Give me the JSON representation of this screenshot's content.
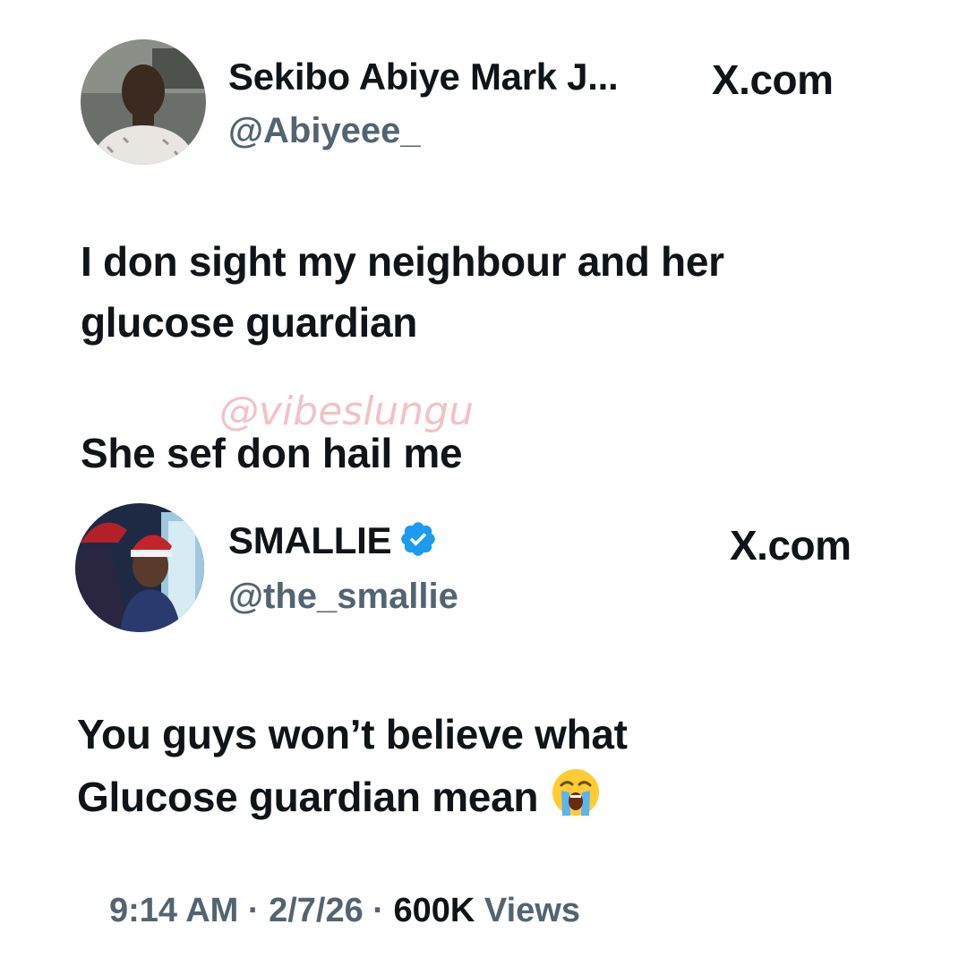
{
  "watermark": "@vibeslungu",
  "tweet1": {
    "display_name": "Sekibo Abiye Mark J...",
    "handle": "@Abiyeee_",
    "source": "X.com",
    "text_line1": "I don sight my neighbour and her",
    "text_line2": "glucose guardian",
    "text_line3": "She sef don hail me"
  },
  "tweet2": {
    "display_name": "SMALLIE",
    "handle": "@the_smallie",
    "source": "X.com",
    "verified": true,
    "text_line1": "You guys won’t believe what",
    "text_line2": "Glucose guardian mean",
    "emoji": "loudly-crying-face"
  },
  "meta": {
    "time": "9:14 AM",
    "sep1": " · ",
    "date": "2/7/26",
    "sep2": " · ",
    "views_count": "600K",
    "views_label": " Views"
  },
  "colors": {
    "text": "#0f1419",
    "secondary": "#536471",
    "verified_blue": "#1d9bf0",
    "watermark": "#f0b8bc"
  }
}
